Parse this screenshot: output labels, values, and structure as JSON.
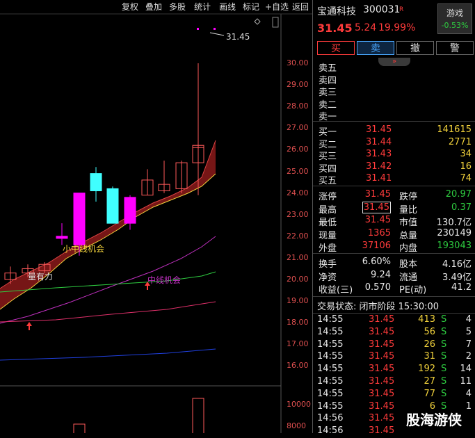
{
  "toolbar": {
    "buttons": [
      "复权",
      "叠加",
      "多股",
      "统计",
      "画线",
      "标记",
      "+自选",
      "返回"
    ]
  },
  "chart": {
    "price_axis": [
      "30.00",
      "29.00",
      "28.00",
      "27.00",
      "26.00",
      "25.00",
      "24.00",
      "23.00",
      "22.00",
      "21.00",
      "20.00",
      "19.00",
      "18.00",
      "17.00",
      "16.00"
    ],
    "volume_axis": [
      "10000",
      "8000"
    ],
    "last_price_label": "31.45",
    "annotations": {
      "small_mid": "小中线机会",
      "mid": "中线机会",
      "strength": "量有力"
    },
    "colors": {
      "up": "#ff00ff",
      "down": "#40ffff",
      "band": "#8b1a1a",
      "ma_yellow": "#f2d23c",
      "ma_green": "#2ecc40",
      "ma_magenta": "#c030c0",
      "ma_pink": "#e0306a",
      "ma_blue": "#2040e0"
    }
  },
  "chart_data": {
    "type": "candlestick",
    "title": "",
    "candles": [
      {
        "open": 20.0,
        "close": 20.3,
        "high": 20.6,
        "low": 19.8,
        "dir": "up"
      },
      {
        "open": 20.3,
        "close": 20.5,
        "high": 20.7,
        "low": 20.1,
        "dir": "up"
      },
      {
        "open": 20.3,
        "close": 20.4,
        "high": 20.6,
        "low": 20.1,
        "dir": "up"
      },
      {
        "open": 20.4,
        "close": 20.7,
        "high": 20.8,
        "low": 20.3,
        "dir": "up"
      },
      {
        "open": 21.9,
        "close": 22.0,
        "high": 22.6,
        "low": 21.6,
        "dir": "up"
      },
      {
        "open": 21.6,
        "close": 24.0,
        "high": 24.0,
        "low": 21.1,
        "dir": "up"
      },
      {
        "open": 24.9,
        "close": 24.1,
        "high": 25.2,
        "low": 23.6,
        "dir": "down"
      },
      {
        "open": 24.2,
        "close": 22.6,
        "high": 24.3,
        "low": 22.6,
        "dir": "down"
      },
      {
        "open": 22.6,
        "close": 23.8,
        "high": 23.9,
        "low": 22.3,
        "dir": "up"
      },
      {
        "open": 23.9,
        "close": 24.6,
        "high": 25.1,
        "low": 23.9,
        "dir": "up"
      },
      {
        "open": 24.1,
        "close": 24.4,
        "high": 25.5,
        "low": 24.0,
        "dir": "up"
      },
      {
        "open": 24.2,
        "close": 25.4,
        "high": 25.5,
        "low": 24.0,
        "dir": "up"
      },
      {
        "open": 25.4,
        "close": 26.2,
        "high": 26.3,
        "low": 24.3,
        "dir": "up"
      },
      {
        "open": 26.1,
        "close": 26.2,
        "high": 30.0,
        "low": 23.9,
        "dir": "up"
      }
    ],
    "ylim": [
      15.5,
      30.5
    ],
    "volume_ticks": [
      10000,
      8000
    ]
  },
  "panel": {
    "stock_name": "宝通科技",
    "stock_code": "300031",
    "badge": "R",
    "price": "31.45",
    "change": "5.24",
    "change_pct": "19.99%",
    "sector": "游戏",
    "sector_pct": "-0.53%",
    "trade_buttons": [
      "买",
      "卖",
      "撤",
      "警"
    ],
    "chevron": "»",
    "sell_levels": [
      {
        "label": "卖五"
      },
      {
        "label": "卖四"
      },
      {
        "label": "卖三"
      },
      {
        "label": "卖二"
      },
      {
        "label": "卖一"
      }
    ],
    "buy_levels": [
      {
        "label": "买一",
        "price": "31.45",
        "vol": "141615"
      },
      {
        "label": "买二",
        "price": "31.44",
        "vol": "2771"
      },
      {
        "label": "买三",
        "price": "31.43",
        "vol": "34"
      },
      {
        "label": "买四",
        "price": "31.42",
        "vol": "16"
      },
      {
        "label": "买五",
        "price": "31.41",
        "vol": "74"
      }
    ],
    "stats": [
      {
        "l1": "涨停",
        "v1": "31.45",
        "l2": "跌停",
        "v2": "20.97"
      },
      {
        "l1": "最高",
        "v1": "31.45",
        "l2": "量比",
        "v2": "0.37"
      },
      {
        "l1": "最低",
        "v1": "31.45",
        "l2": "市值",
        "v2": "130.7亿"
      },
      {
        "l1": "现量",
        "v1": "1365",
        "l2": "总量",
        "v2": "230149"
      },
      {
        "l1": "外盘",
        "v1": "37106",
        "l2": "内盘",
        "v2": "193043"
      }
    ],
    "stats2": [
      {
        "l1": "换手",
        "v1": "6.60%",
        "l2": "股本",
        "v2": "4.16亿"
      },
      {
        "l1": "净资",
        "v1": "9.24",
        "l2": "流通",
        "v2": "3.49亿"
      },
      {
        "l1": "收益(三)",
        "v1": "0.570",
        "l2": "PE(动)",
        "v2": "41.2"
      }
    ],
    "status": "交易状态: 闭市阶段 15:30:00",
    "ticks": [
      {
        "time": "14:55",
        "price": "31.45",
        "vol": "413",
        "side": "S",
        "n": "4"
      },
      {
        "time": "14:55",
        "price": "31.45",
        "vol": "56",
        "side": "S",
        "n": "5"
      },
      {
        "time": "14:55",
        "price": "31.45",
        "vol": "26",
        "side": "S",
        "n": "7"
      },
      {
        "time": "14:55",
        "price": "31.45",
        "vol": "31",
        "side": "S",
        "n": "2"
      },
      {
        "time": "14:55",
        "price": "31.45",
        "vol": "192",
        "side": "S",
        "n": "14"
      },
      {
        "time": "14:55",
        "price": "31.45",
        "vol": "27",
        "side": "S",
        "n": "11"
      },
      {
        "time": "14:55",
        "price": "31.45",
        "vol": "77",
        "side": "S",
        "n": "4"
      },
      {
        "time": "14:55",
        "price": "31.45",
        "vol": "6",
        "side": "S",
        "n": "1"
      },
      {
        "time": "14:56",
        "price": "31.45",
        "vol": "",
        "side": "",
        "n": ""
      },
      {
        "time": "14:56",
        "price": "31.45",
        "vol": "",
        "side": "",
        "n": ""
      }
    ],
    "watermark": "股海游侠"
  }
}
